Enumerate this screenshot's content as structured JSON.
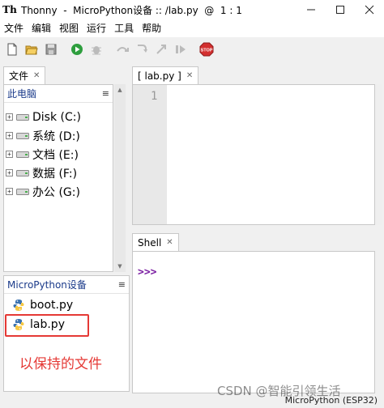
{
  "window": {
    "title": "Thonny  -  MicroPython设备 :: /lab.py  @  1 : 1",
    "app_icon_glyph": "Th"
  },
  "menu": [
    "文件",
    "编辑",
    "视图",
    "运行",
    "工具",
    "帮助"
  ],
  "toolbar": {
    "icons": [
      "new-file-icon",
      "open-file-icon",
      "save-icon",
      "run-icon",
      "debug-icon",
      "step-over-icon",
      "step-into-icon",
      "step-out-icon",
      "resume-icon",
      "stop-icon"
    ],
    "stop_label": "STOP"
  },
  "files_panel": {
    "tab_label": "文件",
    "computer": {
      "header": "此电脑",
      "drives": [
        "Disk (C:)",
        "系统 (D:)",
        "文档 (E:)",
        "数据 (F:)",
        "办公 (G:)"
      ]
    },
    "device": {
      "header": "MicroPython设备",
      "files": [
        "boot.py",
        "lab.py"
      ]
    }
  },
  "editor": {
    "tab_label": "[ lab.py ]",
    "line_number": "1"
  },
  "shell": {
    "tab_label": "Shell",
    "prompt": ">>>"
  },
  "status": {
    "interpreter": "MicroPython (ESP32)"
  },
  "annotation": {
    "text": "以保持的文件",
    "color": "#e53935"
  },
  "watermark": "CSDN @智能引领生活"
}
